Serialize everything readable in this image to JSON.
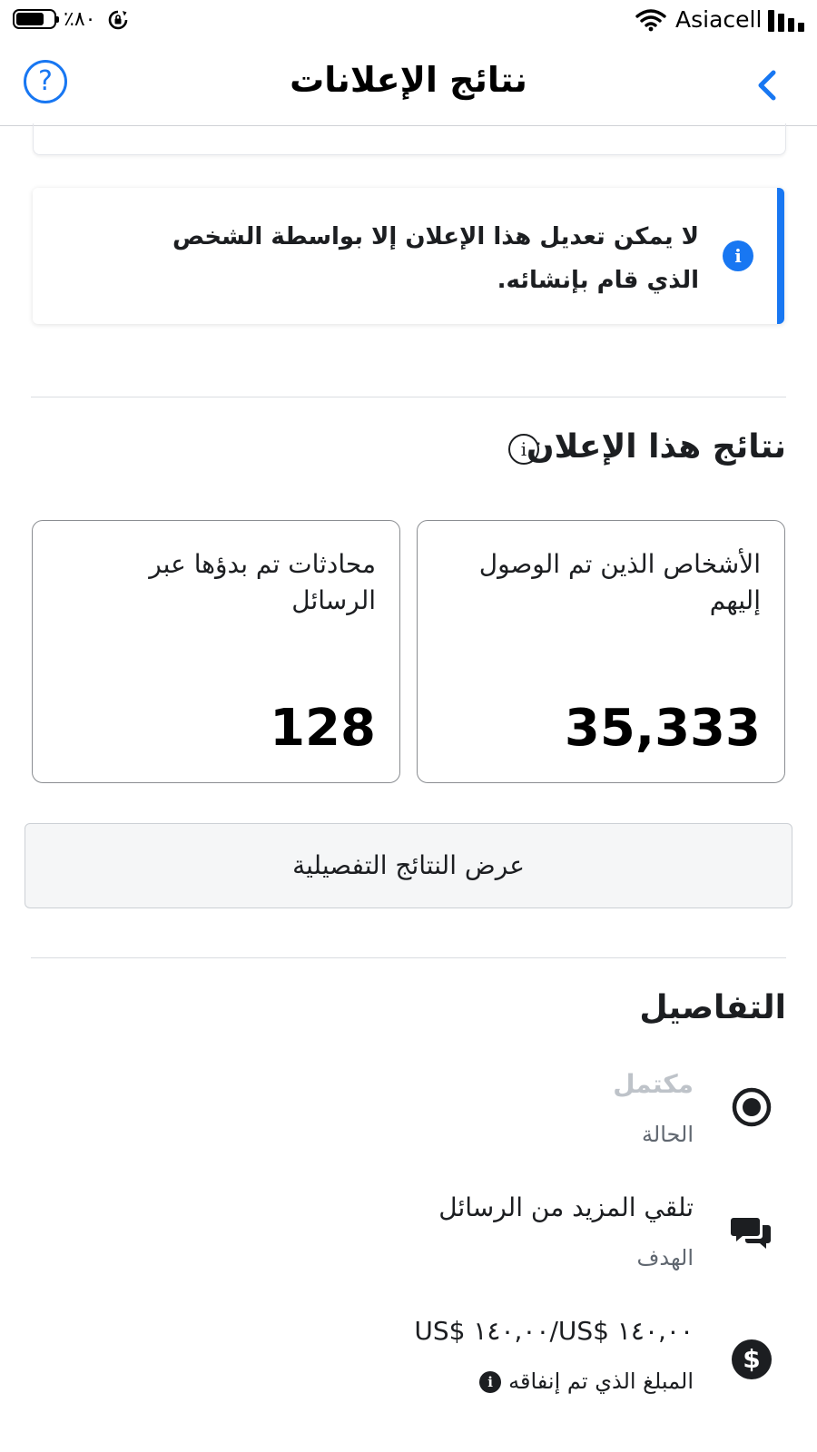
{
  "status_bar": {
    "battery_text": "٪٨٠",
    "battery_level": 0.8,
    "carrier": "Asiacell"
  },
  "header": {
    "title": "نتائج الإعلانات",
    "back_icon": "chevron-left-icon",
    "help_icon": "question-icon",
    "help_label": "?"
  },
  "notice": {
    "text": "لا يمكن تعديل هذا الإعلان إلا بواسطة الشخص الذي قام بإنشائه.",
    "icon": "info-icon",
    "icon_label": "i",
    "accent_color": "#1877f2"
  },
  "results": {
    "title": "نتائج هذا الإعلان",
    "info_label": "i",
    "metrics": [
      {
        "label": "الأشخاص الذين تم الوصول إليهم",
        "value": "35,333"
      },
      {
        "label": "محادثات تم بدؤها عبر الرسائل",
        "value": "128"
      }
    ],
    "detail_button": "عرض النتائج التفصيلية"
  },
  "details": {
    "title": "التفاصيل",
    "rows": [
      {
        "icon": "radio-status-icon",
        "value": "مكتمل",
        "label": "الحالة"
      },
      {
        "icon": "chat-bubbles-icon",
        "value": "تلقي المزيد من الرسائل",
        "label": "الهدف"
      },
      {
        "icon": "dollar-icon",
        "value": "US$ ١٤٠,٠٠/US$ ١٤٠,٠٠",
        "label": "المبلغ الذي تم إنفاقه",
        "info_label": "i"
      }
    ]
  }
}
